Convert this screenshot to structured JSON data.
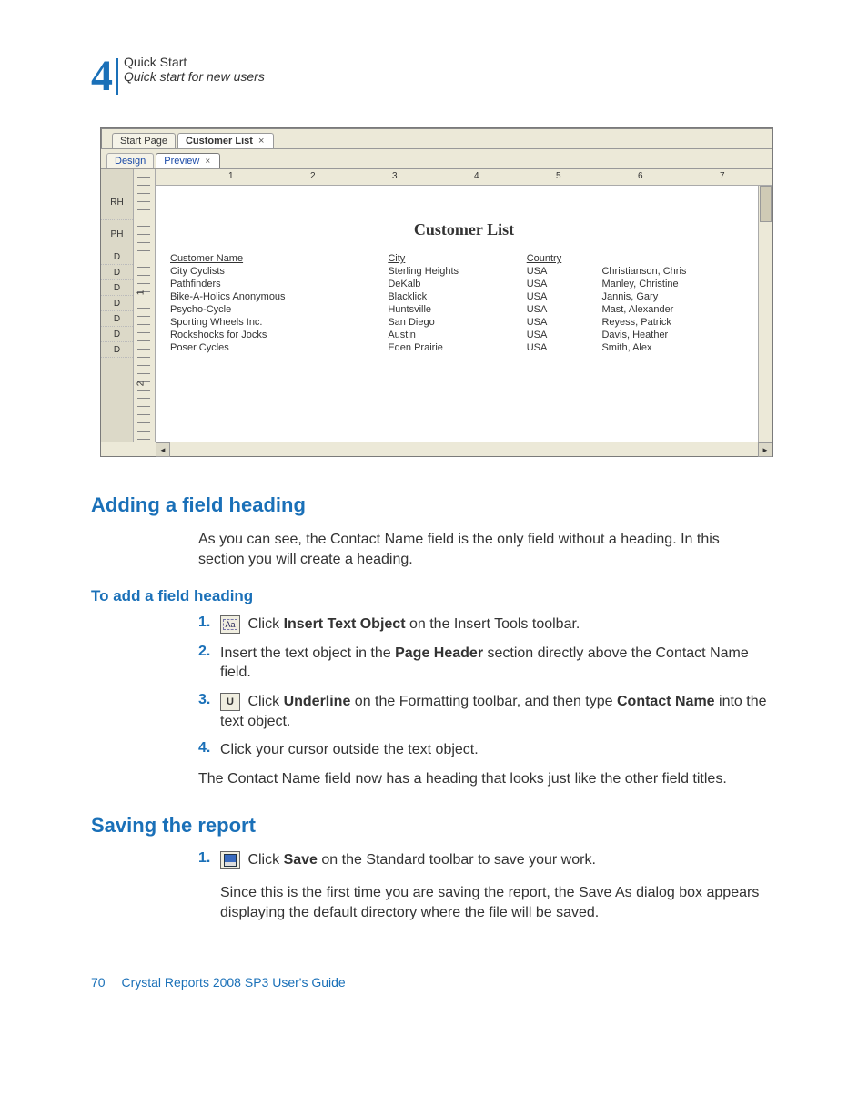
{
  "chapter": {
    "number": "4",
    "title": "Quick Start",
    "subtitle": "Quick start for new users"
  },
  "screenshot": {
    "tabs": {
      "start": "Start Page",
      "active": "Customer List"
    },
    "subtabs": {
      "design": "Design",
      "preview": "Preview"
    },
    "gutter": [
      "RH",
      "PH",
      "D",
      "D",
      "D",
      "D",
      "D",
      "D",
      "D"
    ],
    "vruler": [
      "1",
      "2"
    ],
    "hruler": [
      "1",
      "2",
      "3",
      "4",
      "5",
      "6",
      "7"
    ],
    "report_title": "Customer List",
    "columns": [
      "Customer Name",
      "City",
      "Country",
      ""
    ],
    "rows": [
      [
        "City Cyclists",
        "Sterling Heights",
        "USA",
        "Christianson, Chris"
      ],
      [
        "Pathfinders",
        "DeKalb",
        "USA",
        "Manley, Christine"
      ],
      [
        "Bike-A-Holics Anonymous",
        "Blacklick",
        "USA",
        "Jannis, Gary"
      ],
      [
        "Psycho-Cycle",
        "Huntsville",
        "USA",
        "Mast, Alexander"
      ],
      [
        "Sporting Wheels Inc.",
        "San Diego",
        "USA",
        "Reyess, Patrick"
      ],
      [
        "Rockshocks for Jocks",
        "Austin",
        "USA",
        "Davis, Heather"
      ],
      [
        "Poser Cycles",
        "Eden Prairie",
        "USA",
        "Smith, Alex"
      ]
    ],
    "close_glyph": "×",
    "scroll_left": "◄",
    "scroll_right": "►"
  },
  "sections": {
    "s1_title": "Adding a field heading",
    "s1_intro": "As you can see, the Contact Name field is the only field without a heading. In this section you will create a heading.",
    "task1_title": "To add a field heading",
    "step1_a": " Click ",
    "step1_b": "Insert Text Object",
    "step1_c": " on the Insert Tools toolbar.",
    "step2_a": "Insert the text object in the ",
    "step2_b": "Page Header",
    "step2_c": " section directly above the Contact Name field.",
    "step3_a": " Click ",
    "step3_b": "Underline",
    "step3_c": " on the Formatting toolbar, and then type ",
    "step3_d": "Contact Name",
    "step3_e": " into the text object.",
    "step4": "Click your cursor outside the text object.",
    "s1_outro": "The Contact Name field now has a heading that looks just like the other field titles.",
    "s2_title": "Saving the report",
    "s2_step1_a": " Click ",
    "s2_step1_b": "Save",
    "s2_step1_c": " on the Standard toolbar to save your work.",
    "s2_step1_p2": "Since this is the first time you are saving the report, the Save As dialog box appears displaying the default directory where the file will be saved.",
    "underline_glyph": "U"
  },
  "nums": {
    "n1": "1.",
    "n2": "2.",
    "n3": "3.",
    "n4": "4."
  },
  "footer": {
    "page": "70",
    "guide": "Crystal Reports 2008 SP3 User's Guide"
  }
}
